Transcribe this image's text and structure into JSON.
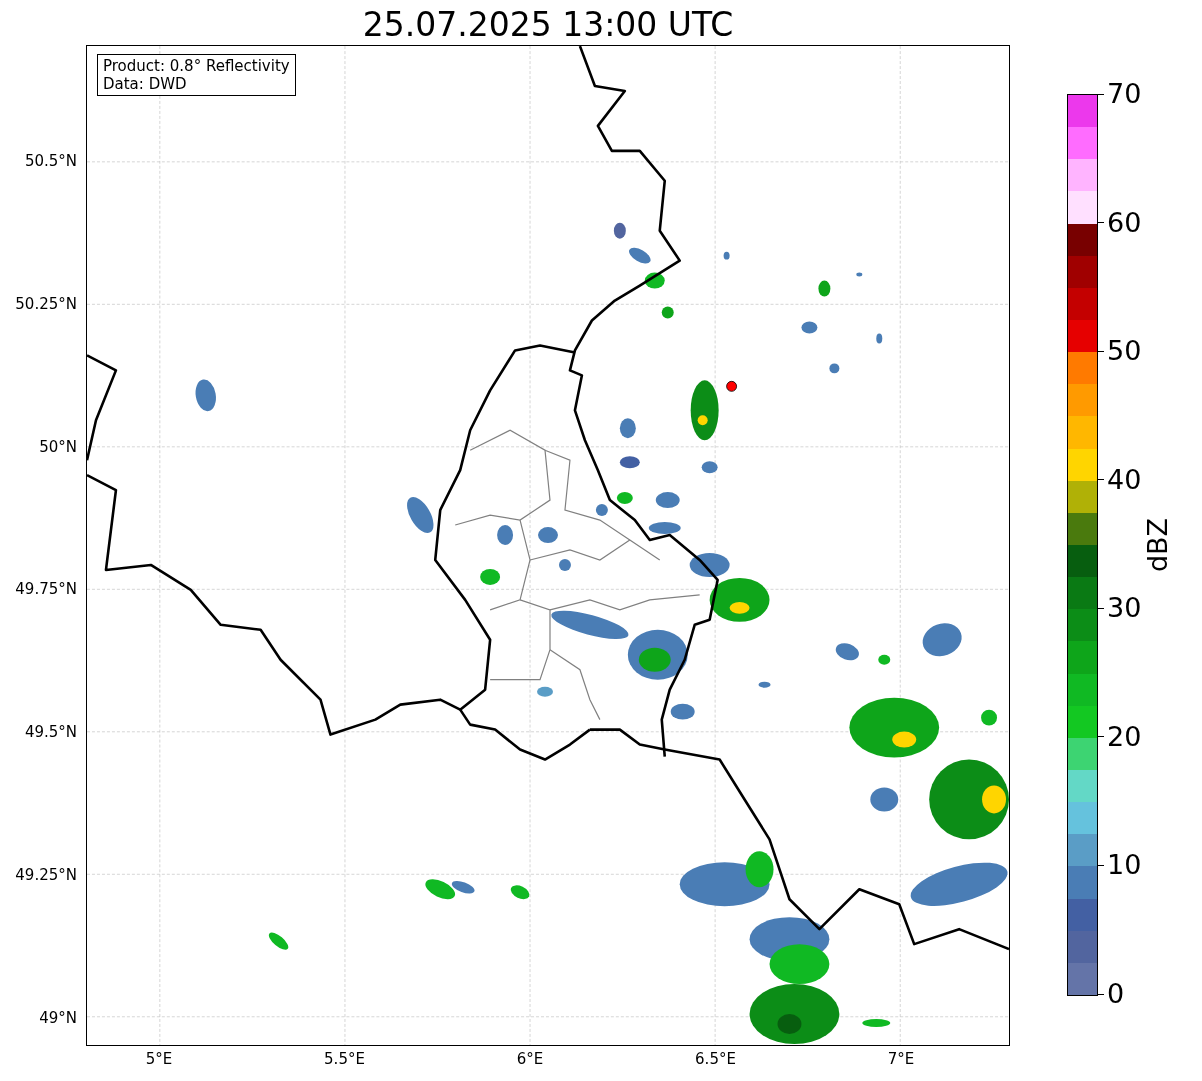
{
  "title": "25.07.2025 13:00 UTC",
  "info_box": [
    "Product: 0.8° Reflectivity",
    "Data: DWD"
  ],
  "map": {
    "x_ticks": [
      "5°E",
      "5.5°E",
      "6°E",
      "6.5°E",
      "7°E"
    ],
    "y_ticks": [
      "50.5°N",
      "50.25°N",
      "50°N",
      "49.75°N",
      "49.5°N",
      "49.25°N",
      "49°N"
    ]
  },
  "colorbar": {
    "label": "dBZ",
    "ticks": [
      "70",
      "60",
      "50",
      "40",
      "30",
      "20",
      "10",
      "0"
    ],
    "segments": [
      {
        "color": "#ec38ec"
      },
      {
        "color": "#ff6cff"
      },
      {
        "color": "#ffb4ff"
      },
      {
        "color": "#ffe0ff"
      },
      {
        "color": "#780000"
      },
      {
        "color": "#a00000"
      },
      {
        "color": "#c40000"
      },
      {
        "color": "#e60000"
      },
      {
        "color": "#ff7a00"
      },
      {
        "color": "#ff9a00"
      },
      {
        "color": "#ffb700"
      },
      {
        "color": "#ffd500"
      },
      {
        "color": "#b0b106"
      },
      {
        "color": "#4a7a0d"
      },
      {
        "color": "#075e0f"
      },
      {
        "color": "#0a7a14"
      },
      {
        "color": "#0c8d17"
      },
      {
        "color": "#0ea51a"
      },
      {
        "color": "#10b923"
      },
      {
        "color": "#13c822"
      },
      {
        "color": "#3dd472"
      },
      {
        "color": "#63d8c6"
      },
      {
        "color": "#65c2dd"
      },
      {
        "color": "#5a9dc6"
      },
      {
        "color": "#4a7db5"
      },
      {
        "color": "#4360a3"
      },
      {
        "color": "#52659f"
      },
      {
        "color": "#6474a8"
      }
    ]
  }
}
